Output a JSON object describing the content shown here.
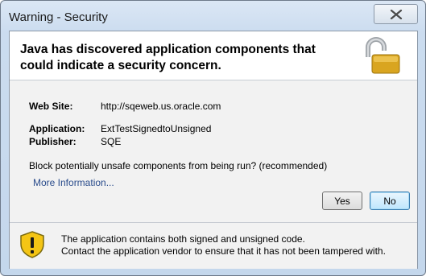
{
  "window": {
    "title": "Warning - Security"
  },
  "header": {
    "headline": "Java has discovered application components that could indicate a security concern.",
    "icon": "unlocked-padlock-icon"
  },
  "details": {
    "web_site_label": "Web Site:",
    "web_site_value": "http://sqeweb.us.oracle.com",
    "application_label": "Application:",
    "application_value": "ExtTestSignedtoUnsigned",
    "publisher_label": "Publisher:",
    "publisher_value": "SQE"
  },
  "question": "Block potentially unsafe components from being run? (recommended)",
  "more_info_link": "More Information...",
  "buttons": {
    "yes": "Yes",
    "no": "No"
  },
  "footer": {
    "icon": "warning-shield-icon",
    "line1": "The application contains both signed and unsigned code.",
    "line2": "Contact the application vendor to ensure that it has not been tampered with."
  },
  "colors": {
    "link": "#2a4c8c",
    "lock_gold": "#d9a520",
    "warning_yellow": "#f4c515"
  }
}
